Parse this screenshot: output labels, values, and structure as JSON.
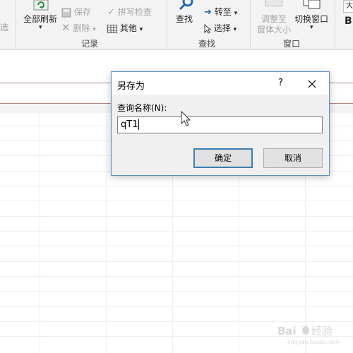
{
  "ribbon": {
    "partial_left_label": "选",
    "refresh_all": "全部刷新",
    "save": "保存",
    "delete": "删除",
    "spell_check": "拼写检查",
    "other": "其他",
    "group_records": "记录",
    "find": "查找",
    "goto": "转至",
    "select": "选择",
    "group_find": "查找",
    "adjust_window_line1": "调整至",
    "adjust_window_line2": "窗体大小",
    "switch_window": "切换窗口",
    "group_window": "窗口",
    "partial_right_label": "大",
    "partial_right_letter": "B"
  },
  "dialog": {
    "title": "另存为",
    "help": "?",
    "label": "查询名称(N):",
    "input_value": "qT1",
    "ok": "确定",
    "cancel": "取消"
  },
  "watermark": {
    "brand_prefix": "Bai",
    "brand_suffix": "经验",
    "url": "jingyan.baidu.com"
  }
}
